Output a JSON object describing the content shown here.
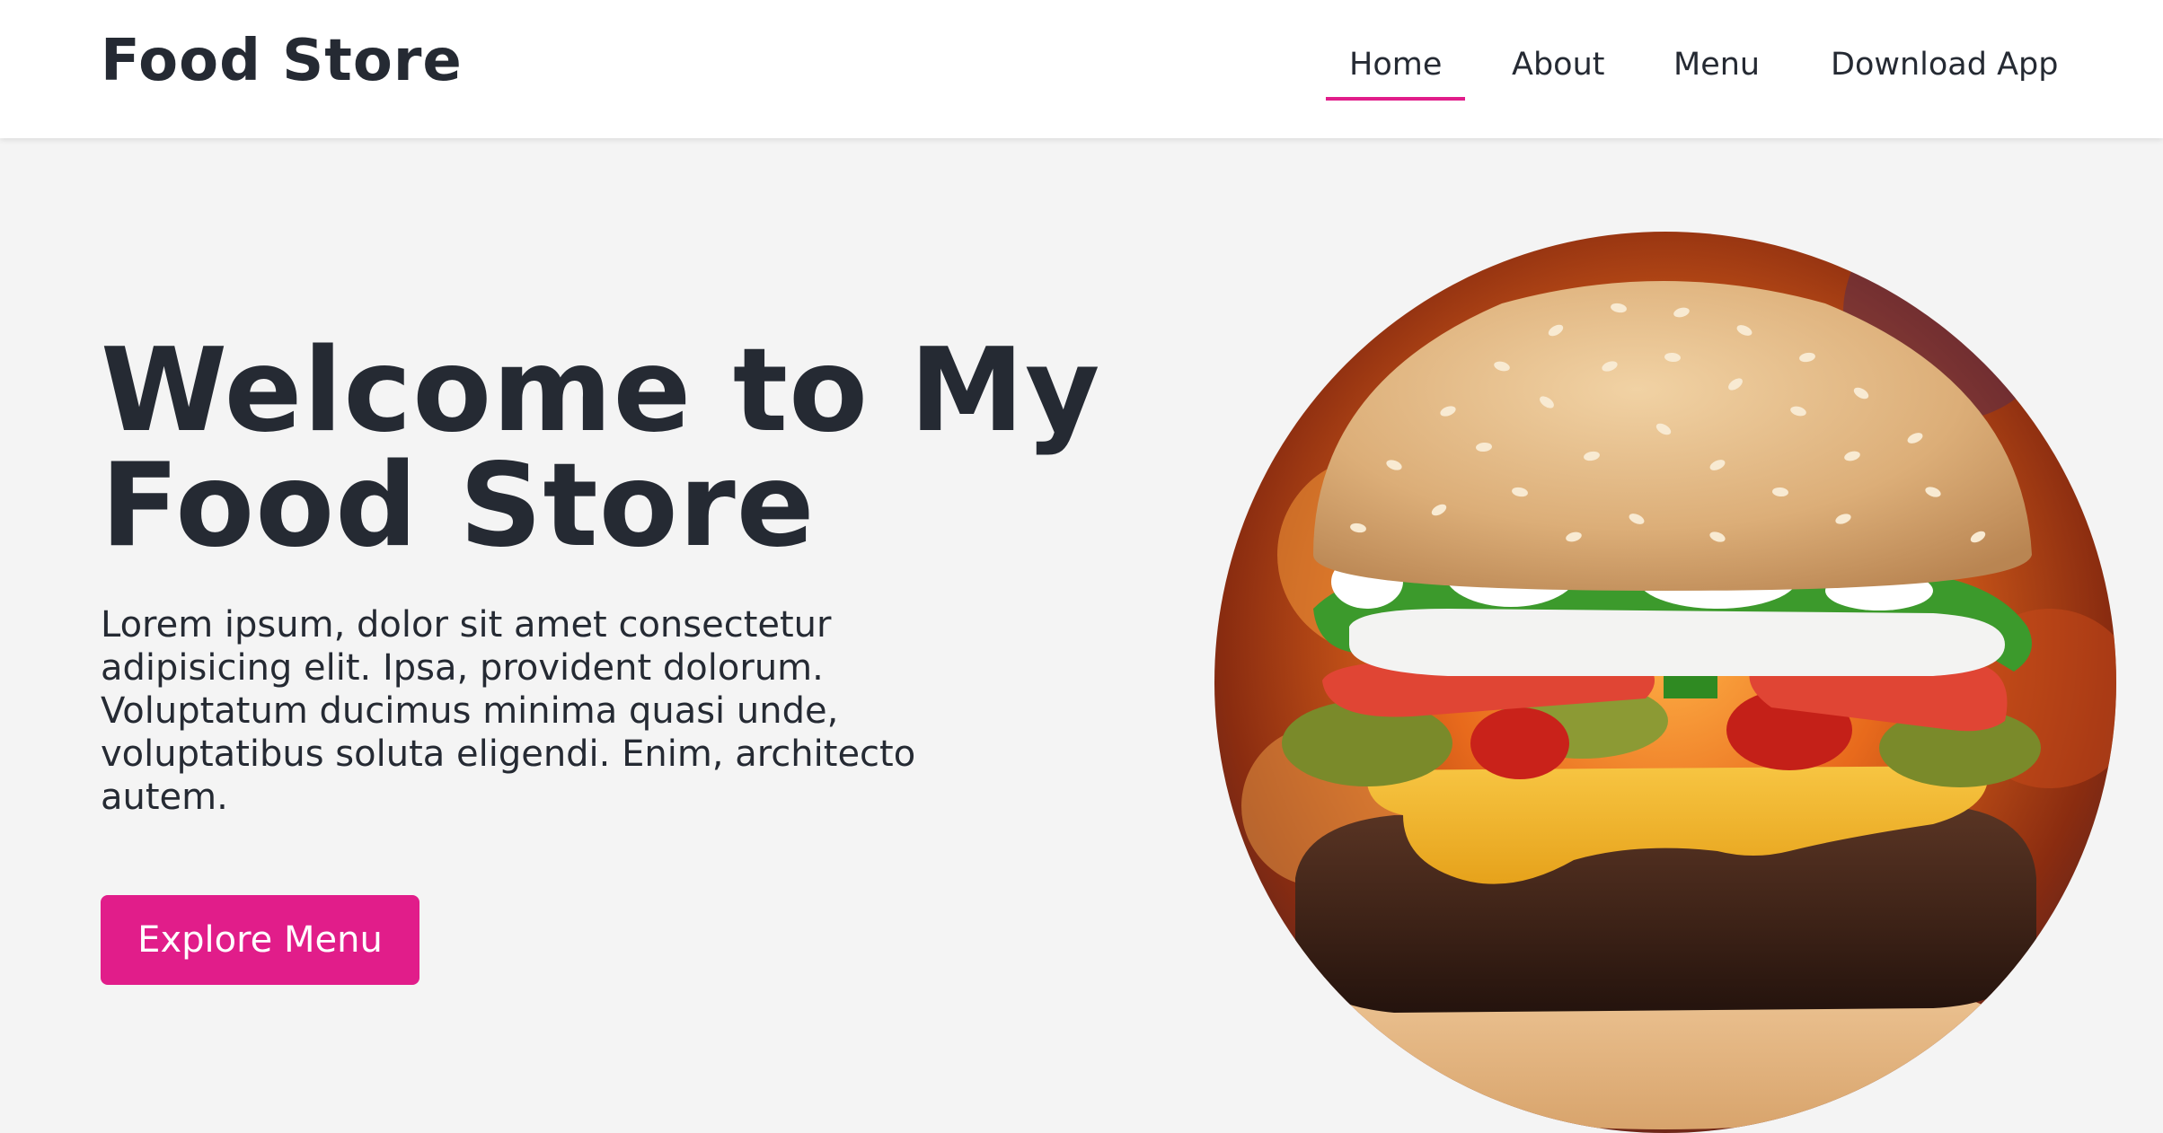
{
  "brand": {
    "title": "Food Store"
  },
  "nav": {
    "items": [
      {
        "label": "Home",
        "active": true
      },
      {
        "label": "About",
        "active": false
      },
      {
        "label": "Menu",
        "active": false
      },
      {
        "label": "Download App",
        "active": false
      }
    ]
  },
  "hero": {
    "title_line1": "Welcome to My",
    "title_line2": "Food Store",
    "text": "Lorem ipsum, dolor sit amet consectetur adipisicing elit. Ipsa, provident dolorum. Voluptatum ducimus minima quasi unde, voluptatibus soluta eligendi. Enim, architecto autem.",
    "cta_label": "Explore Menu",
    "image_icon": "burger-image"
  },
  "colors": {
    "accent": "#e11d8a",
    "text": "#252a33",
    "background": "#f4f4f4",
    "navbar": "#ffffff"
  }
}
